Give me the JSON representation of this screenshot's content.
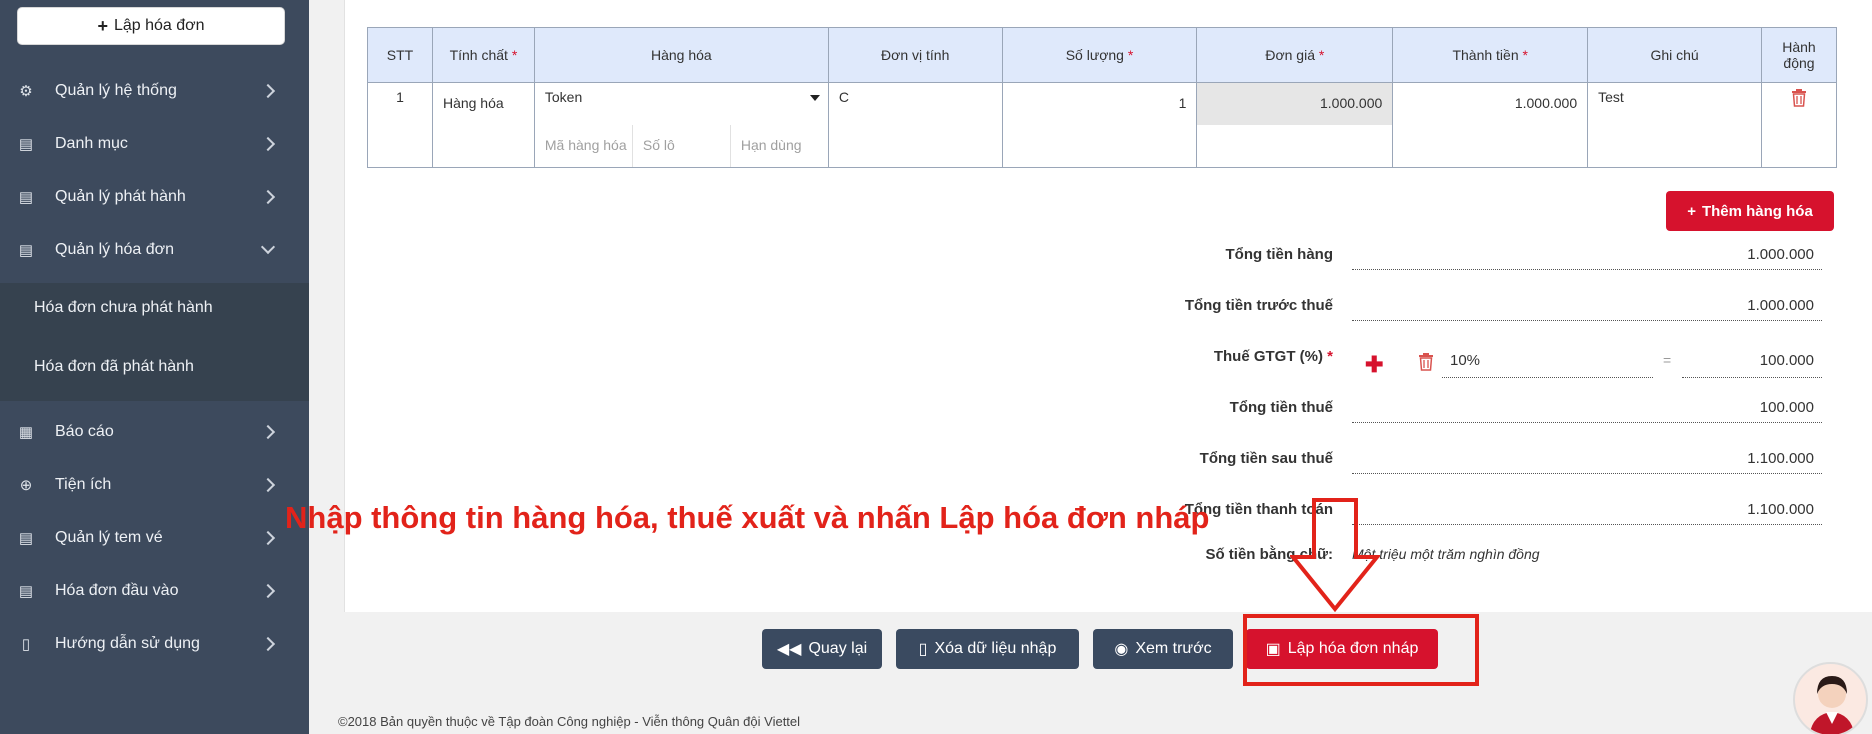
{
  "sidebar": {
    "create_label": "Lập hóa đơn",
    "items": [
      {
        "label": "Quản lý hệ thống",
        "icon": "gear-icon"
      },
      {
        "label": "Danh mục",
        "icon": "list-icon"
      },
      {
        "label": "Quản lý phát hành",
        "icon": "list-icon"
      },
      {
        "label": "Quản lý hóa đơn",
        "icon": "list-icon"
      },
      {
        "label": "Báo cáo",
        "icon": "report-icon"
      },
      {
        "label": "Tiện ích",
        "icon": "search-plus-icon"
      },
      {
        "label": "Quản lý tem vé",
        "icon": "list-icon"
      },
      {
        "label": "Hóa đơn đầu vào",
        "icon": "list-icon"
      },
      {
        "label": "Hướng dẫn sử dụng",
        "icon": "document-icon"
      }
    ],
    "submenu": [
      {
        "label": "Hóa đơn chưa phát hành"
      },
      {
        "label": "Hóa đơn đã phát hành"
      }
    ]
  },
  "table": {
    "headers": {
      "stt": "STT",
      "nature": "Tính chất",
      "goods": "Hàng hóa",
      "unit": "Đơn vị tính",
      "quantity": "Số lượng",
      "unit_price": "Đơn giá",
      "amount": "Thành tiền",
      "note": "Ghi chú",
      "action": "Hành động"
    },
    "row": {
      "stt": "1",
      "nature": "Hàng hóa",
      "goods": "Token",
      "unit": "C",
      "quantity": "1",
      "unit_price": "1.000.000",
      "amount": "1.000.000",
      "note": "Test"
    },
    "sub_placeholders": {
      "code": "Mã hàng hóa",
      "lot": "Số lô",
      "expiry": "Hạn dùng"
    }
  },
  "add_goods_label": "Thêm hàng hóa",
  "summary": {
    "total_goods": {
      "label": "Tổng tiền hàng",
      "value": "1.000.000"
    },
    "before_tax": {
      "label": "Tổng tiền trước thuế",
      "value": "1.000.000"
    },
    "vat": {
      "label": "Thuế GTGT (%)",
      "rate": "10%",
      "equals": "=",
      "value": "100.000"
    },
    "total_tax": {
      "label": "Tổng tiền thuế",
      "value": "100.000"
    },
    "after_tax": {
      "label": "Tổng tiền sau thuế",
      "value": "1.100.000"
    },
    "payment": {
      "label": "Tổng tiền thanh toán",
      "value": "1.100.000"
    },
    "in_words": {
      "label": "Số tiền bằng chữ:",
      "value": "Một triệu một trăm nghìn đồng"
    }
  },
  "actions": {
    "back": "Quay lại",
    "clear": "Xóa dữ liệu nhập",
    "preview": "Xem trước",
    "save_draft": "Lập hóa đơn nháp"
  },
  "footer": "©2018 Bản quyền thuộc về Tập đoàn Công nghiệp - Viễn thông Quân đội Viettel",
  "annotation": "Nhập thông tin hàng hóa, thuế xuất và nhấn Lập hóa đơn nháp",
  "colors": {
    "sidebar": "#3d4a5d",
    "accent": "#d6122d",
    "annotation": "#e2231a",
    "header_bg": "#dfe9fb"
  }
}
